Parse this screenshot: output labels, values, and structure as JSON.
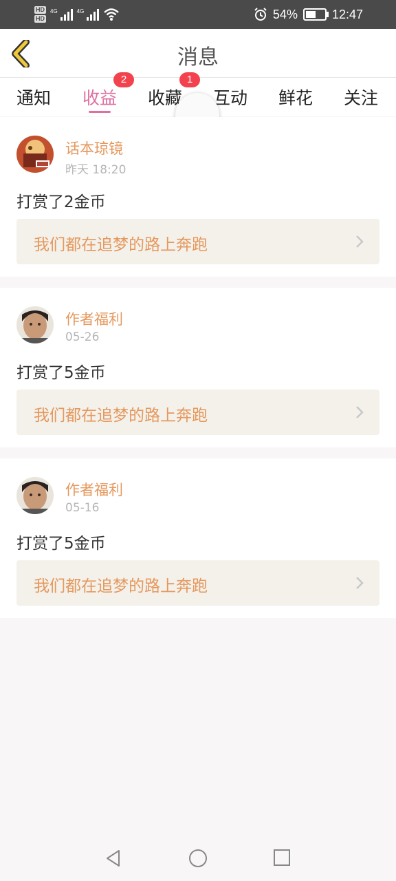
{
  "status_bar": {
    "hd1": "HD",
    "hd2": "HD",
    "net1": "4G",
    "net2": "4G",
    "battery_percent": "54%",
    "battery_level": 0.54,
    "time": "12:47",
    "icons": [
      "signal-icon",
      "wifi-icon",
      "alarm-icon",
      "battery-icon"
    ]
  },
  "header": {
    "title": "消息",
    "back_icon": "chevron-left-icon"
  },
  "tabs": [
    {
      "label": "通知",
      "badge": ""
    },
    {
      "label": "收益",
      "badge": "2",
      "active": true
    },
    {
      "label": "收藏",
      "badge": "1"
    },
    {
      "label": "互动",
      "badge": ""
    },
    {
      "label": "鲜花",
      "badge": ""
    },
    {
      "label": "关注",
      "badge": ""
    }
  ],
  "messages": [
    {
      "name": "话本琼镜",
      "time": "昨天 18:20",
      "text": "打赏了2金币",
      "link": "我们都在追梦的路上奔跑"
    },
    {
      "name": "作者福利",
      "time": "05-26",
      "text": "打赏了5金币",
      "link": "我们都在追梦的路上奔跑"
    },
    {
      "name": "作者福利",
      "time": "05-16",
      "text": "打赏了5金币",
      "link": "我们都在追梦的路上奔跑"
    }
  ],
  "colors": {
    "accent_pink": "#de6fa0",
    "name_orange": "#e5985e",
    "badge_red": "#f2424d",
    "back_yellow": "#f0c93a",
    "statusbar_bg": "#4a4a4a"
  },
  "nav_bar": {
    "icons": [
      "back-triangle-icon",
      "home-circle-icon",
      "recents-square-icon"
    ]
  }
}
